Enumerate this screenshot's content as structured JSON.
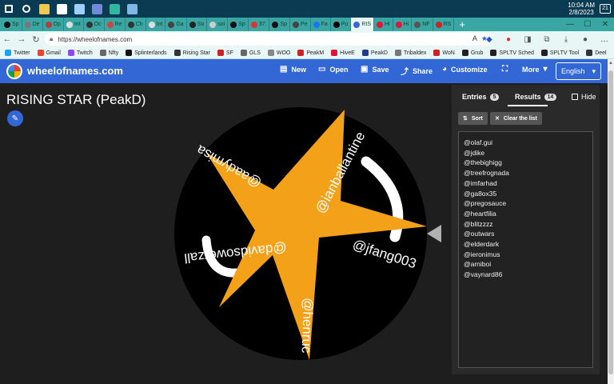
{
  "taskbar": {
    "icons": [
      {
        "name": "windows-icon",
        "color": "#ffffff"
      },
      {
        "name": "search-icon",
        "color": "#ffffff"
      },
      {
        "name": "file-explorer-icon",
        "color": "#f2c94c"
      },
      {
        "name": "github-icon",
        "color": "#ffffff"
      },
      {
        "name": "steam-icon",
        "color": "#9ecfff"
      },
      {
        "name": "discord-icon",
        "color": "#7289da"
      },
      {
        "name": "edge-icon",
        "color": "#2fb7a0"
      },
      {
        "name": "notepad-icon",
        "color": "#7fb8e6"
      }
    ],
    "time": "10:04 AM",
    "date": "2/8/2023",
    "notifications": "21"
  },
  "browser": {
    "tabs": [
      {
        "label": "Sp",
        "color": "#111111",
        "active": false
      },
      {
        "label": "De",
        "color": "#777777",
        "active": false
      },
      {
        "label": "Op",
        "color": "#b04040",
        "active": false
      },
      {
        "label": "Int",
        "color": "#dddddd",
        "active": false
      },
      {
        "label": "Oc",
        "color": "#333333",
        "active": false
      },
      {
        "label": "Re",
        "color": "#cc4444",
        "active": false
      },
      {
        "label": "Ch",
        "color": "#333333",
        "active": false
      },
      {
        "label": "Int",
        "color": "#dddddd",
        "active": false
      },
      {
        "label": "Ga",
        "color": "#444444",
        "active": false
      },
      {
        "label": "So",
        "color": "#222222",
        "active": false
      },
      {
        "label": "soi",
        "color": "#cccccc",
        "active": false
      },
      {
        "label": "Sp",
        "color": "#111111",
        "active": false
      },
      {
        "label": "37:",
        "color": "#dd3333",
        "active": false
      },
      {
        "label": "Sp",
        "color": "#111111",
        "active": false
      },
      {
        "label": "Pe",
        "color": "#444444",
        "active": false
      },
      {
        "label": "Fa",
        "color": "#1877f2",
        "active": false
      },
      {
        "label": "Pu",
        "color": "#000000",
        "active": false
      },
      {
        "label": "RIS",
        "color": "#3367d6",
        "active": true
      },
      {
        "label": "Hi",
        "color": "#e31337",
        "active": false
      },
      {
        "label": "Hi",
        "color": "#e31337",
        "active": false
      },
      {
        "label": "NF",
        "color": "#555555",
        "active": false
      },
      {
        "label": "RS",
        "color": "#cc2222",
        "active": false
      }
    ],
    "new_tab": "+",
    "window_controls": {
      "minimize": "—",
      "maximize": "☐",
      "close": "✕"
    },
    "nav": {
      "back": "←",
      "forward": "→",
      "refresh": "↻"
    },
    "url": "https://wheelofnames.com",
    "url_icons": {
      "read_aloud": "A",
      "favorite": "★"
    },
    "toolbar_icons": [
      {
        "name": "nf-icon",
        "glyph": "◆",
        "color": "#2255cc"
      },
      {
        "name": "extension-icon",
        "glyph": "●",
        "color": "#dd3333"
      },
      {
        "name": "split-screen-icon",
        "glyph": "◨",
        "color": "#555555"
      },
      {
        "name": "collections-icon",
        "glyph": "⧉",
        "color": "#555555"
      },
      {
        "name": "downloads-icon",
        "glyph": "⤓",
        "color": "#555555"
      },
      {
        "name": "profile-avatar-icon",
        "glyph": "●",
        "color": "#555555"
      },
      {
        "name": "menu-dots-icon",
        "glyph": "…",
        "color": "#333333"
      }
    ],
    "bookmarks": [
      {
        "label": "Twitter",
        "color": "#1da1f2"
      },
      {
        "label": "Gmail",
        "color": "#ea4335"
      },
      {
        "label": "Twitch",
        "color": "#9146ff"
      },
      {
        "label": "Nfty",
        "color": "#666666"
      },
      {
        "label": "Splinterlands",
        "color": "#111111"
      },
      {
        "label": "Rising Star",
        "color": "#333333"
      },
      {
        "label": "SF",
        "color": "#cc2222"
      },
      {
        "label": "GLS",
        "color": "#666666"
      },
      {
        "label": "WOO",
        "color": "#888888"
      },
      {
        "label": "PeakM",
        "color": "#cc2222"
      },
      {
        "label": "HiveE",
        "color": "#e31337"
      },
      {
        "label": "PeakD",
        "color": "#1f3a93"
      },
      {
        "label": "Tribaldex",
        "color": "#777777"
      },
      {
        "label": "WoN",
        "color": "#cc2222"
      },
      {
        "label": "Grub",
        "color": "#222222"
      },
      {
        "label": "SPLTV Sched",
        "color": "#222222"
      },
      {
        "label": "SPLTV Tool",
        "color": "#222222"
      },
      {
        "label": "Deel",
        "color": "#333333"
      }
    ]
  },
  "app": {
    "brand": "wheelofnames.com",
    "menu": [
      {
        "label": "New",
        "icon": "new-file-icon",
        "glyph": "▤"
      },
      {
        "label": "Open",
        "icon": "folder-open-icon",
        "glyph": "▭"
      },
      {
        "label": "Save",
        "icon": "save-icon",
        "glyph": "▣"
      },
      {
        "label": "Share",
        "icon": "share-icon",
        "glyph": "⤴"
      },
      {
        "label": "Customize",
        "icon": "palette-icon",
        "glyph": "◕"
      },
      {
        "label": "",
        "icon": "fullscreen-icon",
        "glyph": "⛶"
      },
      {
        "label": "More",
        "icon": "chevron-down-icon",
        "glyph": "▾"
      }
    ],
    "language": "English",
    "language_arrow": "▾",
    "title": "RISING STAR (PeakD)",
    "edit_glyph": "✎"
  },
  "wheel": {
    "colors": {
      "background": "#000000",
      "star": "#f4a11a",
      "pointer": "#b0b0b0",
      "text": "#ffffff"
    },
    "labels": [
      "@aadymisa",
      "@ianballantine",
      "@jfang003",
      "@henruc",
      "@davidsowerzall"
    ]
  },
  "panel": {
    "tabs": [
      {
        "label": "Entries",
        "count": "5",
        "active": false
      },
      {
        "label": "Results",
        "count": "14",
        "active": true
      }
    ],
    "hide_label": "Hide",
    "sort_label": "Sort",
    "sort_glyph": "⇅",
    "clear_label": "Clear the list",
    "clear_glyph": "✕",
    "results": [
      "@olaf.gui",
      "@jdike",
      "@thebighigg",
      "@treefrognada",
      "@imfarhad",
      "@ga8ox35",
      "@pregosauce",
      "@heartfilia",
      "@blitzzzz",
      "@outwars",
      "@elderdark",
      "@ieronimus",
      "@arniboi",
      "@vaynard86"
    ]
  }
}
